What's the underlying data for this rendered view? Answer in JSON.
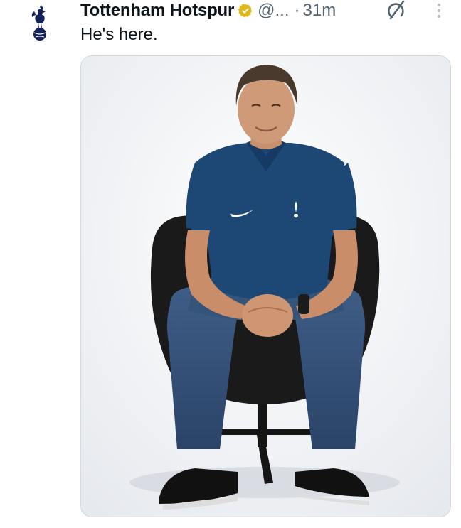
{
  "tweet": {
    "author": {
      "display_name": "Tottenham Hotspur",
      "handle": "@...",
      "verified_badge_color": "#e2b719",
      "avatar_icon": "spurs-cockerel-crest-icon"
    },
    "separator": "·",
    "timestamp": "31m",
    "text": "He's here.",
    "media": {
      "kind": "photo",
      "description_icon": "manager-portrait-photo"
    },
    "actions": {
      "grok_icon": "grok-icon",
      "more_icon": "more-vertical-icon"
    }
  },
  "colors": {
    "text_primary": "#0f1419",
    "text_secondary": "#536471",
    "border": "#cfd9de",
    "club_navy": "#132257"
  }
}
